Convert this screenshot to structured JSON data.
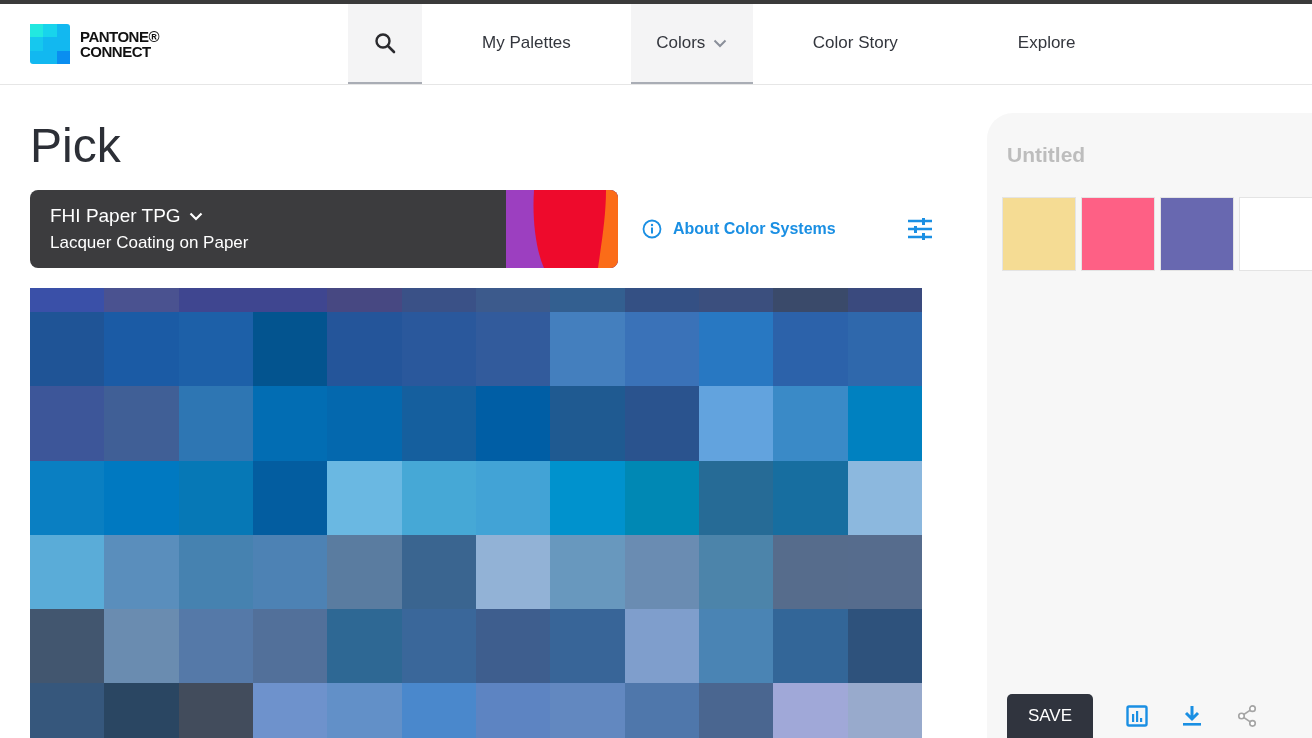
{
  "brand": {
    "line_1": "PANTONE®",
    "line_2": "CONNECT"
  },
  "nav": [
    {
      "kind": "search",
      "selected": true
    },
    {
      "kind": "link",
      "label": "My Palettes",
      "selected": false
    },
    {
      "kind": "dropdown",
      "label": "Colors",
      "selected": true
    },
    {
      "kind": "link",
      "label": "Color Story",
      "selected": false
    },
    {
      "kind": "link",
      "label": "Explore",
      "selected": false
    }
  ],
  "heading": "Pick",
  "picker": {
    "system": "FHI Paper TPG",
    "subtitle": "Lacquer Coating on Paper"
  },
  "about_link": "About Color Systems",
  "swatches": [
    [
      {
        "color": "#3a50a8"
      },
      {
        "color": "#4a5290"
      },
      {
        "color": "#3f4690"
      },
      {
        "color": "#3f4690"
      },
      {
        "color": "#474882"
      },
      {
        "color": "#3a5187"
      },
      {
        "color": "#3c5a8c"
      },
      {
        "color": "#335f90"
      },
      {
        "color": "#345084"
      },
      {
        "color": "#3b4f7e"
      },
      {
        "color": "#3a4a6a"
      },
      {
        "color": "#3a4a7e"
      }
    ],
    [
      {
        "color": "#1f5496"
      },
      {
        "color": "#1b5ba5"
      },
      {
        "color": "#1d60a8"
      },
      {
        "color": "#03548f"
      },
      {
        "color": "#24559a"
      },
      {
        "color": "#2a589c"
      },
      {
        "color": "#325b9c"
      },
      {
        "color": "#447fbe"
      },
      {
        "color": "#3a72b8"
      },
      {
        "color": "#2878c2"
      },
      {
        "color": "#2c62aa"
      },
      {
        "color": "#2f68ac"
      }
    ],
    [
      {
        "color": "#3d5699"
      },
      {
        "color": "#405f96"
      },
      {
        "color": "#2e76b3"
      },
      {
        "color": "#026db3"
      },
      {
        "color": "#0468ae"
      },
      {
        "color": "#155f9e"
      },
      {
        "color": "#005ea5"
      },
      {
        "color": "#1f5a91"
      },
      {
        "color": "#2a538e"
      },
      {
        "color": "#62a3de"
      },
      {
        "color": "#3a8ac7"
      },
      {
        "color": "#0081c0"
      }
    ],
    [
      {
        "color": "#0a7fc2"
      },
      {
        "color": "#0079c1"
      },
      {
        "color": "#0678b6"
      },
      {
        "color": "#035da0"
      },
      {
        "color": "#6ab8e2"
      },
      {
        "color": "#46a8d6"
      },
      {
        "color": "#42a3d6"
      },
      {
        "color": "#0092cd"
      },
      {
        "color": "#0088b4"
      },
      {
        "color": "#266b96"
      },
      {
        "color": "#176ea0"
      },
      {
        "color": "#8cb8de"
      }
    ],
    [
      {
        "color": "#5aacd8"
      },
      {
        "color": "#5a8ebc"
      },
      {
        "color": "#4682b0"
      },
      {
        "color": "#4d82b4"
      },
      {
        "color": "#5a7ca0"
      },
      {
        "color": "#3a6590"
      },
      {
        "color": "#92b2d6"
      },
      {
        "color": "#6898be"
      },
      {
        "color": "#6a8cb2"
      },
      {
        "color": "#4c84aa"
      },
      {
        "color": "#566c8c"
      },
      {
        "color": "#566c8d"
      }
    ],
    [
      {
        "color": "#42566f"
      },
      {
        "color": "#6a8cb0"
      },
      {
        "color": "#5579a8"
      },
      {
        "color": "#52709a"
      },
      {
        "color": "#2e6894"
      },
      {
        "color": "#3a679a"
      },
      {
        "color": "#3e5e8e"
      },
      {
        "color": "#386598"
      },
      {
        "color": "#7f9ecc"
      },
      {
        "color": "#4a84b4"
      },
      {
        "color": "#336698"
      },
      {
        "color": "#2e527c"
      }
    ],
    [
      {
        "color": "#36577c"
      },
      {
        "color": "#2a4662"
      },
      {
        "color": "#424c5c"
      },
      {
        "color": "#6e92cc"
      },
      {
        "color": "#6290c8"
      },
      {
        "color": "#4a88cc"
      },
      {
        "color": "#5d84c2"
      },
      {
        "color": "#6288c0"
      },
      {
        "color": "#4f77ab"
      },
      {
        "color": "#4a6690"
      },
      {
        "color": "#a0a8d8"
      },
      {
        "color": "#98aacc"
      }
    ]
  ],
  "palette": {
    "title": "Untitled",
    "colors": [
      {
        "color": "#f5dc94"
      },
      {
        "color": "#fe6085"
      },
      {
        "color": "#6868b0"
      },
      {
        "color": "#ffffff"
      }
    ],
    "save_button": "SAVE"
  }
}
